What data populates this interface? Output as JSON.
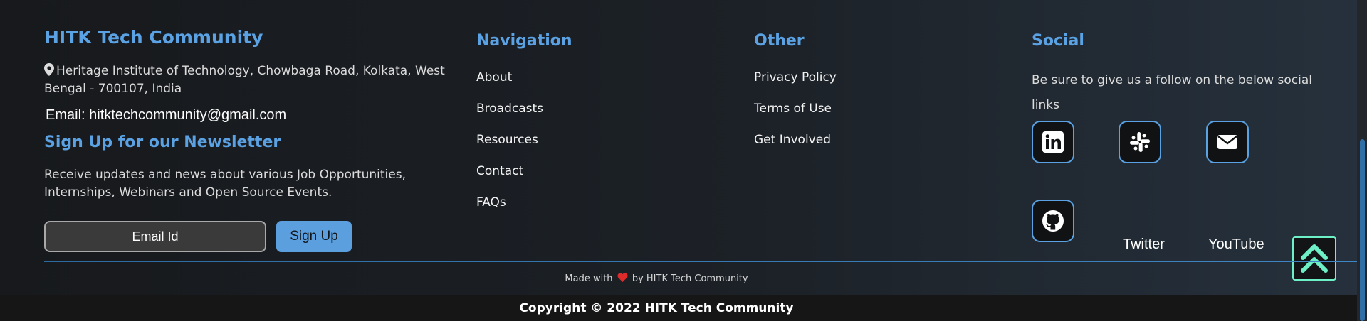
{
  "brand": {
    "title": "HITK Tech Community",
    "address": "Heritage Institute of Technology, Chowbaga Road, Kolkata, West Bengal - 700107, India",
    "email": "Email: hitktechcommunity@gmail.com"
  },
  "newsletter": {
    "title": "Sign Up for our Newsletter",
    "description": "Receive updates and news about various Job Opportunities, Internships, Webinars and Open Source Events.",
    "input_placeholder": "Email Id",
    "button_label": "Sign Up"
  },
  "navigation": {
    "title": "Navigation",
    "items": [
      "About",
      "Broadcasts",
      "Resources",
      "Contact",
      "FAQs"
    ]
  },
  "other": {
    "title": "Other",
    "items": [
      "Privacy Policy",
      "Terms of Use",
      "Get Involved"
    ]
  },
  "social": {
    "title": "Social",
    "description": "Be sure to give us a follow on the below social links",
    "icons": [
      "linkedin-icon",
      "slack-icon",
      "mail-icon",
      "github-icon"
    ],
    "text_links": [
      "Twitter",
      "YouTube"
    ]
  },
  "bottom": {
    "made_with_prefix": "Made with",
    "made_with_suffix": "by HITK Tech Community",
    "copyright": "Copyright © 2022 HITK Tech Community"
  },
  "colors": {
    "accent": "#5aa2e3",
    "scroll_top_accent": "#6ef0c6",
    "heart": "#e02b2b",
    "background": "#1c2127"
  }
}
